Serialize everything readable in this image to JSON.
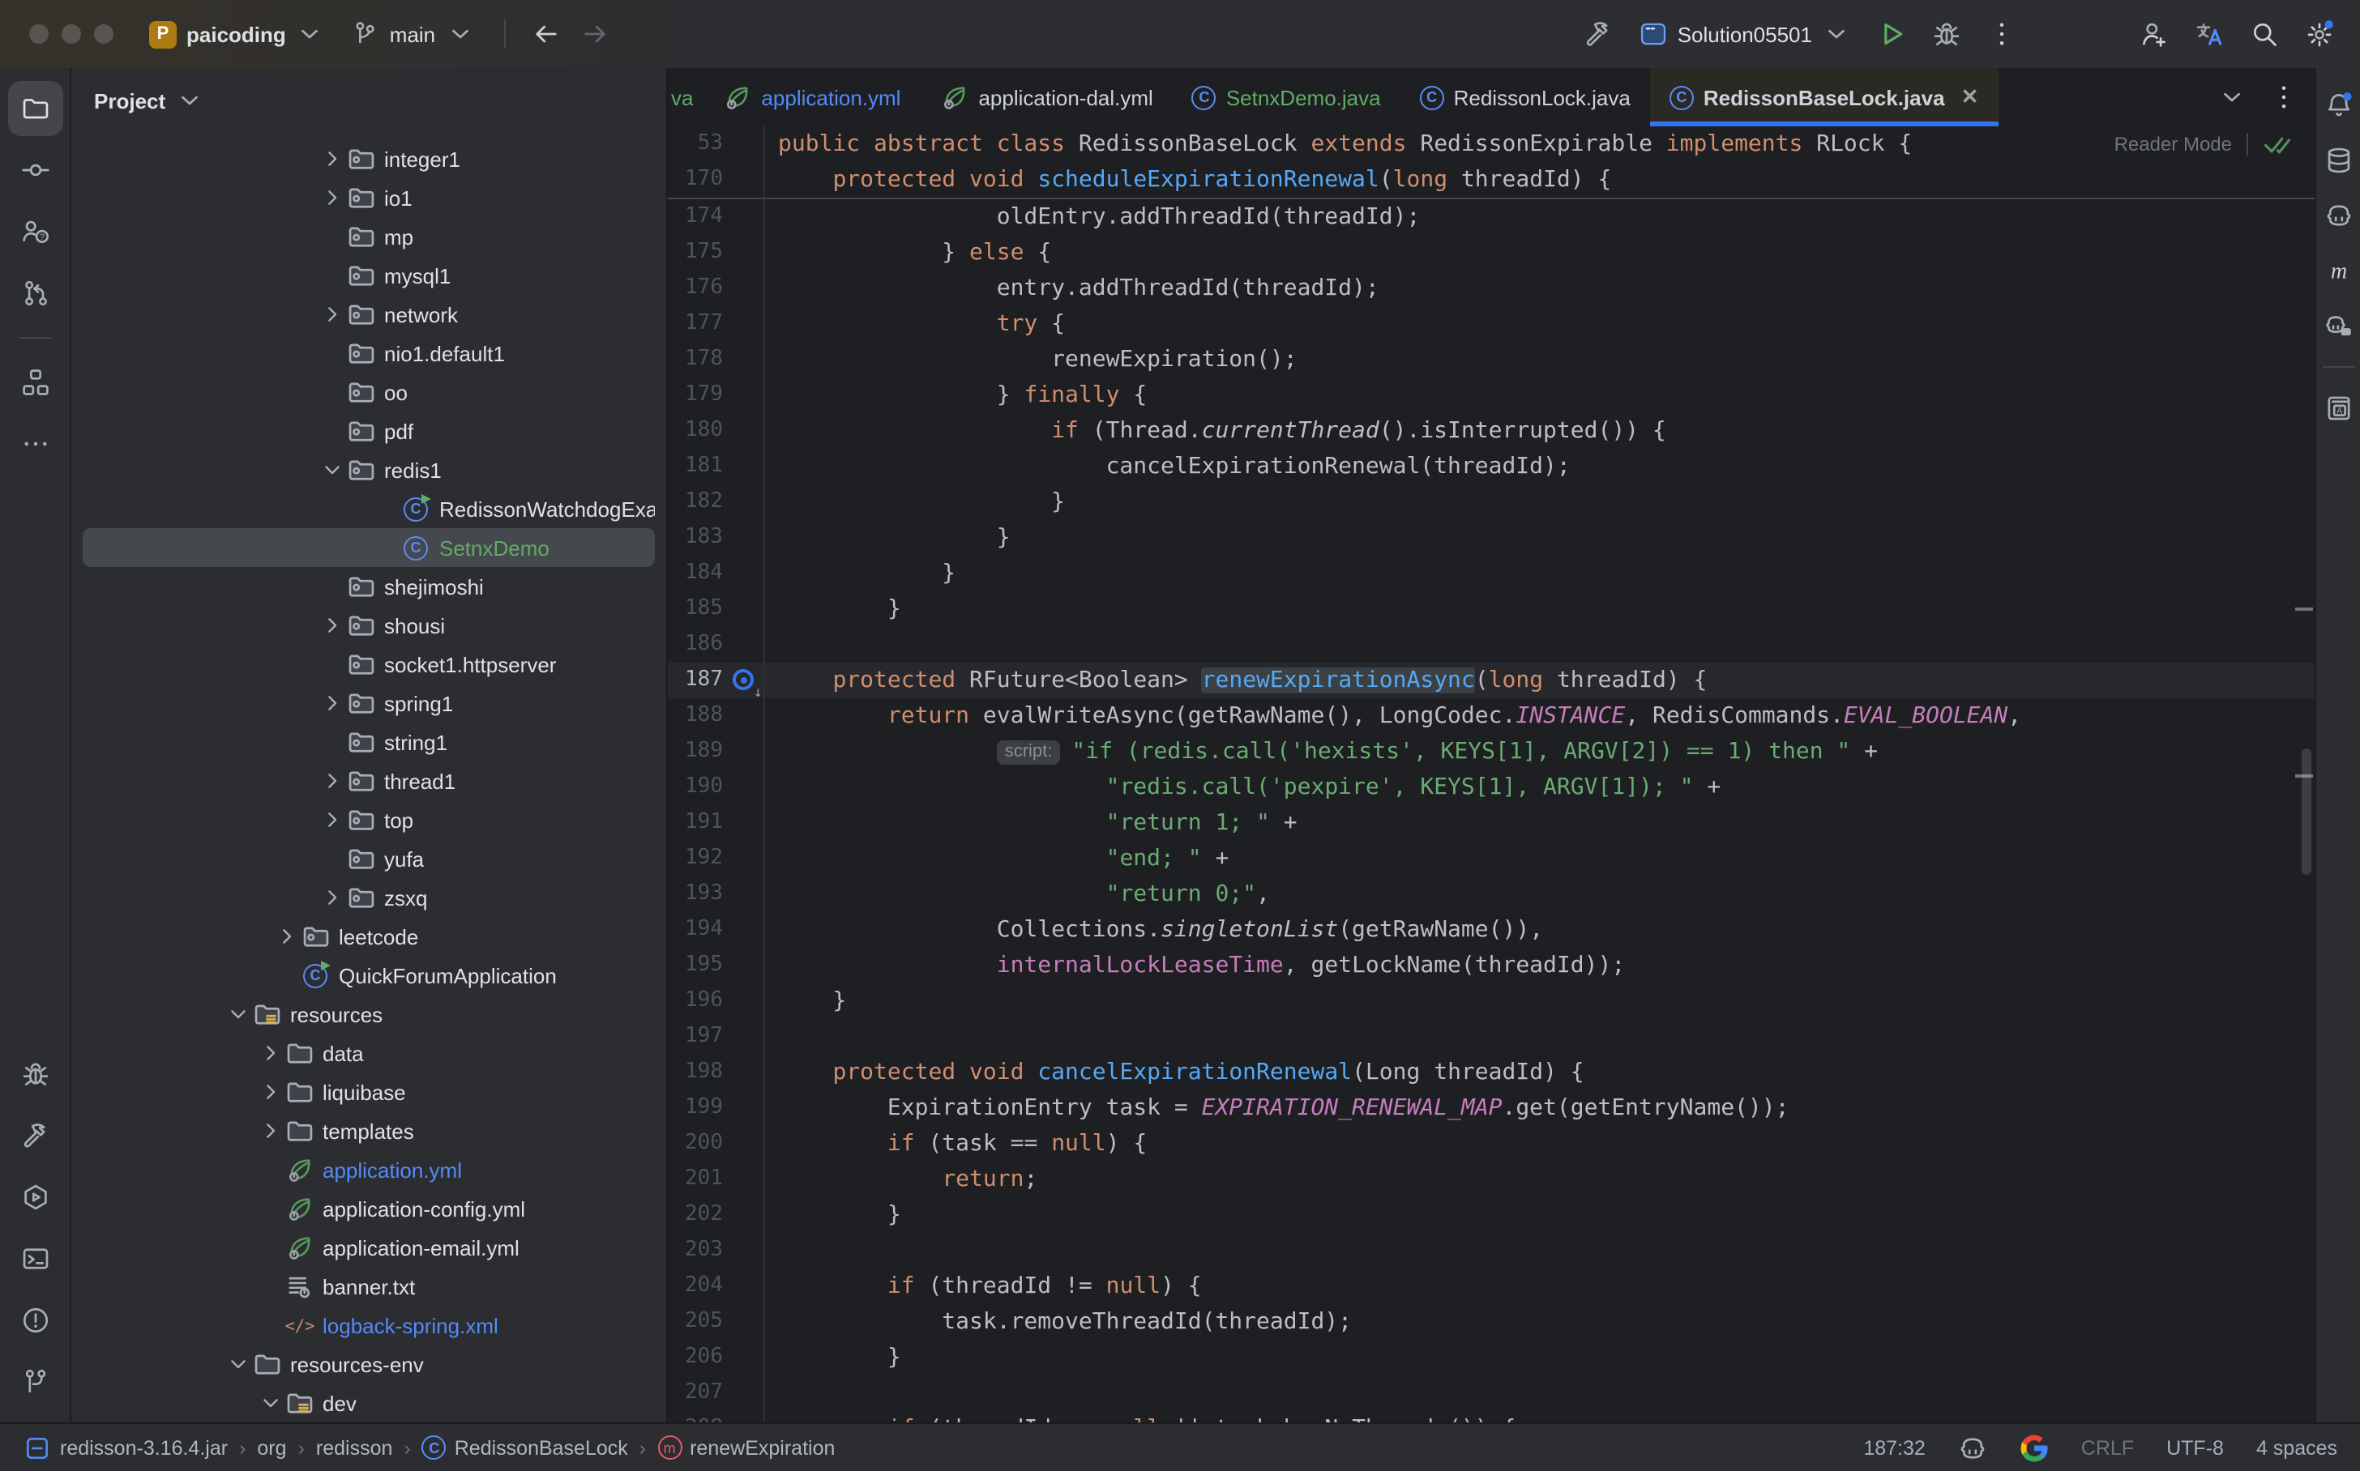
{
  "titlebar": {
    "project_name": "paicoding",
    "branch_name": "main",
    "run_config": "Solution05501"
  },
  "project_panel": {
    "title": "Project",
    "items": [
      {
        "label": "integer1",
        "icon": "pkg",
        "chevron": "right",
        "depth": 4
      },
      {
        "label": "io1",
        "icon": "pkg",
        "chevron": "right",
        "depth": 4
      },
      {
        "label": "mp",
        "icon": "pkg",
        "chevron": "none",
        "depth": 4
      },
      {
        "label": "mysql1",
        "icon": "pkg",
        "chevron": "none",
        "depth": 4
      },
      {
        "label": "network",
        "icon": "pkg",
        "chevron": "right",
        "depth": 4
      },
      {
        "label": "nio1.default1",
        "icon": "pkg",
        "chevron": "none",
        "depth": 4
      },
      {
        "label": "oo",
        "icon": "pkg",
        "chevron": "none",
        "depth": 4
      },
      {
        "label": "pdf",
        "icon": "pkg",
        "chevron": "none",
        "depth": 4
      },
      {
        "label": "redis1",
        "icon": "pkg",
        "chevron": "down",
        "depth": 4
      },
      {
        "label": "RedissonWatchdogExample",
        "icon": "class-run",
        "chevron": "none",
        "depth": 5
      },
      {
        "label": "SetnxDemo",
        "icon": "class",
        "chevron": "none",
        "depth": 5,
        "color": "green",
        "selected": true
      },
      {
        "label": "shejimoshi",
        "icon": "pkg",
        "chevron": "none",
        "depth": 4
      },
      {
        "label": "shousi",
        "icon": "pkg",
        "chevron": "right",
        "depth": 4
      },
      {
        "label": "socket1.httpserver",
        "icon": "pkg",
        "chevron": "none",
        "depth": 4
      },
      {
        "label": "spring1",
        "icon": "pkg",
        "chevron": "right",
        "depth": 4
      },
      {
        "label": "string1",
        "icon": "pkg",
        "chevron": "none",
        "depth": 4
      },
      {
        "label": "thread1",
        "icon": "pkg",
        "chevron": "right",
        "depth": 4
      },
      {
        "label": "top",
        "icon": "pkg",
        "chevron": "right",
        "depth": 4
      },
      {
        "label": "yufa",
        "icon": "pkg",
        "chevron": "none",
        "depth": 4
      },
      {
        "label": "zsxq",
        "icon": "pkg",
        "chevron": "right",
        "depth": 4
      },
      {
        "label": "leetcode",
        "icon": "pkg",
        "chevron": "right",
        "depth": 3
      },
      {
        "label": "QuickForumApplication",
        "icon": "spring-run",
        "chevron": "none",
        "depth": 3
      },
      {
        "label": "resources",
        "icon": "folder-res",
        "chevron": "down",
        "depth": 1
      },
      {
        "label": "data",
        "icon": "folder",
        "chevron": "right",
        "depth": 2
      },
      {
        "label": "liquibase",
        "icon": "folder",
        "chevron": "right",
        "depth": 2
      },
      {
        "label": "templates",
        "icon": "folder",
        "chevron": "right",
        "depth": 2
      },
      {
        "label": "application.yml",
        "icon": "spring-file",
        "chevron": "none",
        "depth": 2,
        "color": "blue"
      },
      {
        "label": "application-config.yml",
        "icon": "spring-file",
        "chevron": "none",
        "depth": 2
      },
      {
        "label": "application-email.yml",
        "icon": "spring-file",
        "chevron": "none",
        "depth": 2
      },
      {
        "label": "banner.txt",
        "icon": "text-file",
        "chevron": "none",
        "depth": 2
      },
      {
        "label": "logback-spring.xml",
        "icon": "xml-file",
        "chevron": "none",
        "depth": 2,
        "color": "blue"
      },
      {
        "label": "resources-env",
        "icon": "folder",
        "chevron": "down",
        "depth": 1
      },
      {
        "label": "dev",
        "icon": "folder-res",
        "chevron": "down",
        "depth": 2
      }
    ]
  },
  "tabbar": {
    "tabs": [
      {
        "label": "va",
        "icon": null,
        "color": "green",
        "partial": true
      },
      {
        "label": "application.yml",
        "icon": "spring-file",
        "color": "blue"
      },
      {
        "label": "application-dal.yml",
        "icon": "spring-file",
        "color": "default"
      },
      {
        "label": "SetnxDemo.java",
        "icon": "class",
        "color": "green"
      },
      {
        "label": "RedissonLock.java",
        "icon": "class",
        "color": "default"
      },
      {
        "label": "RedissonBaseLock.java",
        "icon": "class",
        "color": "default",
        "active": true,
        "close": true
      }
    ]
  },
  "editor": {
    "reader_mode_label": "Reader Mode",
    "sticky_lines": [
      {
        "n": "53",
        "seg": [
          [
            "k",
            "public abstract class "
          ],
          [
            "d",
            "RedissonBaseLock "
          ],
          [
            "k",
            "extends "
          ],
          [
            "d",
            "RedissonExpirable "
          ],
          [
            "k",
            "implements "
          ],
          [
            "d",
            "RLock {"
          ]
        ]
      },
      {
        "n": "170",
        "seg": [
          [
            "d",
            "    "
          ],
          [
            "k",
            "protected void "
          ],
          [
            "m",
            "scheduleExpirationRenewal"
          ],
          [
            "d",
            "("
          ],
          [
            "k",
            "long"
          ],
          [
            "d",
            " threadId) {"
          ]
        ]
      }
    ],
    "lines": [
      {
        "n": "174",
        "seg": [
          [
            "d",
            "                oldEntry.addThreadId(threadId);"
          ]
        ]
      },
      {
        "n": "175",
        "seg": [
          [
            "d",
            "            } "
          ],
          [
            "k",
            "else"
          ],
          [
            "d",
            " {"
          ]
        ]
      },
      {
        "n": "176",
        "seg": [
          [
            "d",
            "                entry.addThreadId(threadId);"
          ]
        ]
      },
      {
        "n": "177",
        "seg": [
          [
            "d",
            "                "
          ],
          [
            "k",
            "try"
          ],
          [
            "d",
            " {"
          ]
        ]
      },
      {
        "n": "178",
        "seg": [
          [
            "d",
            "                    renewExpiration();"
          ]
        ]
      },
      {
        "n": "179",
        "seg": [
          [
            "d",
            "                } "
          ],
          [
            "k",
            "finally"
          ],
          [
            "d",
            " {"
          ]
        ]
      },
      {
        "n": "180",
        "seg": [
          [
            "d",
            "                    "
          ],
          [
            "k",
            "if"
          ],
          [
            "d",
            " (Thread."
          ],
          [
            "i",
            "currentThread"
          ],
          [
            "d",
            "().isInterrupted()) {"
          ]
        ]
      },
      {
        "n": "181",
        "seg": [
          [
            "d",
            "                        cancelExpirationRenewal(threadId);"
          ]
        ]
      },
      {
        "n": "182",
        "seg": [
          [
            "d",
            "                    }"
          ]
        ]
      },
      {
        "n": "183",
        "seg": [
          [
            "d",
            "                }"
          ]
        ]
      },
      {
        "n": "184",
        "seg": [
          [
            "d",
            "            }"
          ]
        ]
      },
      {
        "n": "185",
        "seg": [
          [
            "d",
            "        }"
          ]
        ]
      },
      {
        "n": "186",
        "seg": []
      },
      {
        "n": "187",
        "current": true,
        "gutter_icon": "override",
        "seg": [
          [
            "d",
            "    "
          ],
          [
            "k",
            "protected "
          ],
          [
            "d",
            "RFuture<Boolean> "
          ],
          [
            "h",
            "renewExpirationAsync"
          ],
          [
            "d",
            "("
          ],
          [
            "k",
            "long"
          ],
          [
            "d",
            " threadId) {"
          ]
        ]
      },
      {
        "n": "188",
        "seg": [
          [
            "d",
            "        "
          ],
          [
            "k",
            "return "
          ],
          [
            "d",
            "evalWriteAsync(getRawName(), LongCodec."
          ],
          [
            "c",
            "INSTANCE"
          ],
          [
            "d",
            ", RedisCommands."
          ],
          [
            "c",
            "EVAL_BOOLEAN"
          ],
          [
            "d",
            ","
          ]
        ]
      },
      {
        "n": "189",
        "seg": [
          [
            "d",
            "                "
          ],
          [
            "chip",
            "script:"
          ],
          [
            "s",
            "\"if (redis.call('hexists', KEYS[1], ARGV[2]) == 1) then \""
          ],
          [
            "d",
            " +"
          ]
        ]
      },
      {
        "n": "190",
        "seg": [
          [
            "d",
            "                        "
          ],
          [
            "s",
            "\"redis.call('pexpire', KEYS[1], ARGV[1]); \""
          ],
          [
            "d",
            " +"
          ]
        ]
      },
      {
        "n": "191",
        "seg": [
          [
            "d",
            "                        "
          ],
          [
            "s",
            "\"return 1; \""
          ],
          [
            "d",
            " +"
          ]
        ]
      },
      {
        "n": "192",
        "seg": [
          [
            "d",
            "                        "
          ],
          [
            "s",
            "\"end; \""
          ],
          [
            "d",
            " +"
          ]
        ]
      },
      {
        "n": "193",
        "seg": [
          [
            "d",
            "                        "
          ],
          [
            "s",
            "\"return 0;\""
          ],
          [
            "d",
            ","
          ]
        ]
      },
      {
        "n": "194",
        "seg": [
          [
            "d",
            "                Collections."
          ],
          [
            "i",
            "singletonList"
          ],
          [
            "d",
            "(getRawName()),"
          ]
        ]
      },
      {
        "n": "195",
        "seg": [
          [
            "d",
            "                "
          ],
          [
            "f",
            "internalLockLeaseTime"
          ],
          [
            "d",
            ", getLockName(threadId));"
          ]
        ]
      },
      {
        "n": "196",
        "seg": [
          [
            "d",
            "    }"
          ]
        ]
      },
      {
        "n": "197",
        "seg": []
      },
      {
        "n": "198",
        "seg": [
          [
            "d",
            "    "
          ],
          [
            "k",
            "protected void "
          ],
          [
            "m",
            "cancelExpirationRenewal"
          ],
          [
            "d",
            "(Long threadId) {"
          ]
        ]
      },
      {
        "n": "199",
        "seg": [
          [
            "d",
            "        ExpirationEntry task = "
          ],
          [
            "c",
            "EXPIRATION_RENEWAL_MAP"
          ],
          [
            "d",
            ".get(getEntryName());"
          ]
        ]
      },
      {
        "n": "200",
        "seg": [
          [
            "d",
            "        "
          ],
          [
            "k",
            "if"
          ],
          [
            "d",
            " (task == "
          ],
          [
            "k",
            "null"
          ],
          [
            "d",
            ") {"
          ]
        ]
      },
      {
        "n": "201",
        "seg": [
          [
            "d",
            "            "
          ],
          [
            "k",
            "return"
          ],
          [
            "d",
            ";"
          ]
        ]
      },
      {
        "n": "202",
        "seg": [
          [
            "d",
            "        }"
          ]
        ]
      },
      {
        "n": "203",
        "seg": []
      },
      {
        "n": "204",
        "seg": [
          [
            "d",
            "        "
          ],
          [
            "k",
            "if"
          ],
          [
            "d",
            " (threadId != "
          ],
          [
            "k",
            "null"
          ],
          [
            "d",
            ") {"
          ]
        ]
      },
      {
        "n": "205",
        "seg": [
          [
            "d",
            "            task.removeThreadId(threadId);"
          ]
        ]
      },
      {
        "n": "206",
        "seg": [
          [
            "d",
            "        }"
          ]
        ]
      },
      {
        "n": "207",
        "seg": []
      },
      {
        "n": "208",
        "seg": [
          [
            "d",
            "        "
          ],
          [
            "k",
            "if"
          ],
          [
            "d",
            " (threadId == "
          ],
          [
            "k",
            "null"
          ],
          [
            "d",
            " || task.hasNoThreads()) {"
          ]
        ]
      }
    ]
  },
  "left_toolbar_top": [
    "project-folder",
    "commit",
    "code-review",
    "vcs-graph",
    "divider",
    "structure",
    "more"
  ],
  "left_toolbar_bottom": [
    "debug",
    "build",
    "services",
    "terminal",
    "problems",
    "git-branch"
  ],
  "right_toolbar": [
    "notifications",
    "database",
    "copilot",
    "maven",
    "copilot-chat",
    "divider",
    "dictionary"
  ],
  "statusbar": {
    "breadcrumbs": [
      {
        "icon": "jar",
        "label": "redisson-3.16.4.jar"
      },
      {
        "icon": null,
        "label": "org"
      },
      {
        "icon": null,
        "label": "redisson"
      },
      {
        "icon": "class",
        "label": "RedissonBaseLock"
      },
      {
        "icon": "method",
        "label": "renewExpiration"
      }
    ],
    "caret": "187:32",
    "line_ending": "CRLF",
    "encoding": "UTF-8",
    "indent": "4 spaces"
  },
  "colors": {
    "accent": "#3574f0",
    "green": "#5fad65",
    "blue_text": "#548af7",
    "keyword": "#cf8e6d",
    "string": "#6aab73",
    "constant": "#c77dbb",
    "method": "#56a8f5",
    "selection_bg": "#45484d",
    "active_tab_bg": "#2b2923"
  }
}
